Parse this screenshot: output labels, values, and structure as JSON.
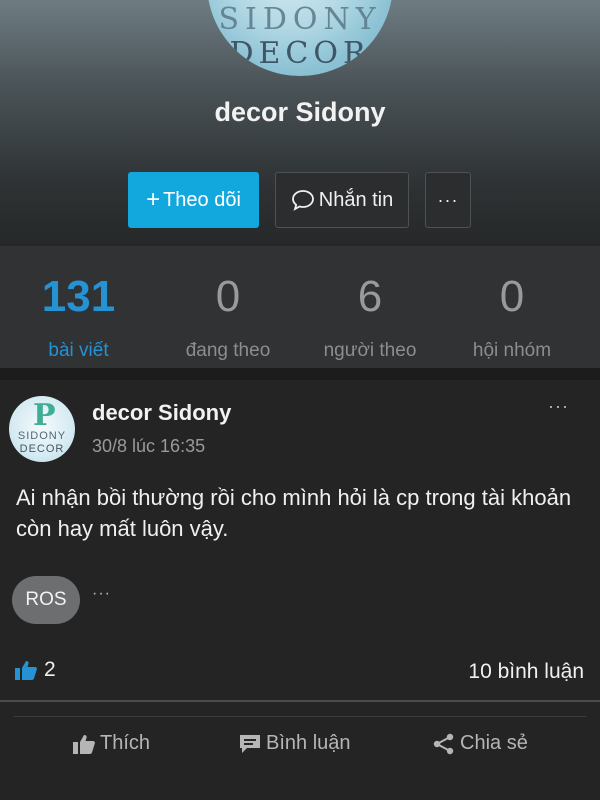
{
  "profile": {
    "logo_line1": "SIDONY",
    "logo_line2": "DECOR",
    "name": "decor Sidony",
    "follow_label": "Theo dõi",
    "message_label": "Nhắn tin",
    "more_label": "···"
  },
  "stats": [
    {
      "value": "131",
      "label": "bài viết"
    },
    {
      "value": "0",
      "label": "đang theo"
    },
    {
      "value": "6",
      "label": "người theo"
    },
    {
      "value": "0",
      "label": "hội nhóm"
    }
  ],
  "post": {
    "avatar_text1": "SIDONY",
    "avatar_text2": "DECOR",
    "author": "decor Sidony",
    "time": "30/8 lúc 16:35",
    "more_label": "···",
    "content": "Ai nhận bồi thường rồi cho mình hỏi là cp trong tài khoản còn hay mất luôn vậy.",
    "tag": "ROS",
    "tag_more": "···",
    "likes_count": "2",
    "comments_count": "10 bình luận",
    "actions": {
      "like": "Thích",
      "comment": "Bình luận",
      "share": "Chia sẻ"
    }
  },
  "colors": {
    "accent": "#13a8dd",
    "active_stat": "#2592d3",
    "background": "#242424"
  }
}
